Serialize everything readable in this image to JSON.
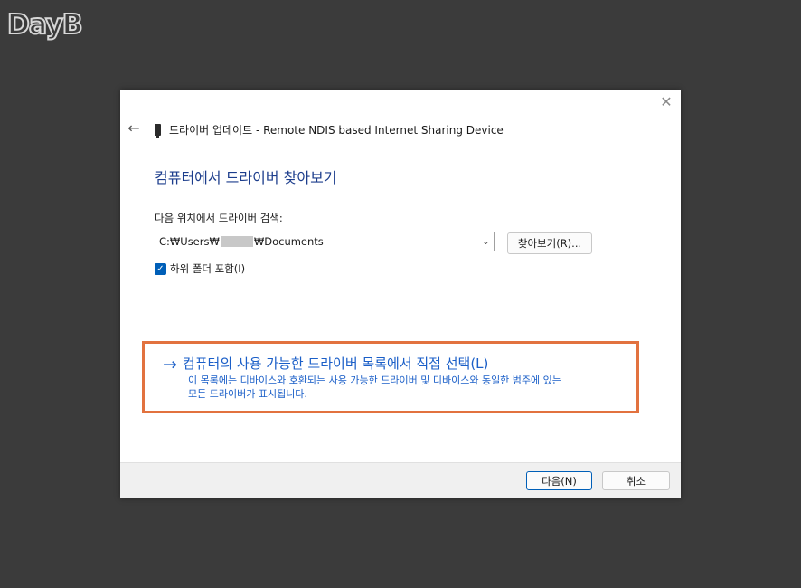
{
  "watermark": {
    "text": "DayB"
  },
  "window": {
    "close_glyph": "✕",
    "back_glyph": "←",
    "title": "드라이버 업데이트 - Remote NDIS based Internet Sharing Device"
  },
  "main": {
    "heading": "컴퓨터에서 드라이버 찾아보기",
    "search_label": "다음 위치에서 드라이버 검색:",
    "path_prefix": "C:₩Users₩",
    "path_suffix": "₩Documents",
    "browse_label": "찾아보기(R)...",
    "include_subfolders_label": "하위 폴더 포함(I)",
    "include_subfolders_checked": true,
    "pick_arrow": "→",
    "pick_label": "컴퓨터의 사용 가능한 드라이버 목록에서 직접 선택(L)",
    "pick_desc_line1": "이 목록에는 디바이스와 호환되는 사용 가능한 드라이버 및 디바이스와 동일한 범주에 있는",
    "pick_desc_line2": "모든 드라이버가 표시됩니다."
  },
  "footer": {
    "next_label": "다음(N)",
    "cancel_label": "취소"
  },
  "colors": {
    "accent": "#005fb8",
    "link": "#1b5fc8",
    "highlight_border": "#e2723f",
    "heading": "#1c3d8c"
  }
}
